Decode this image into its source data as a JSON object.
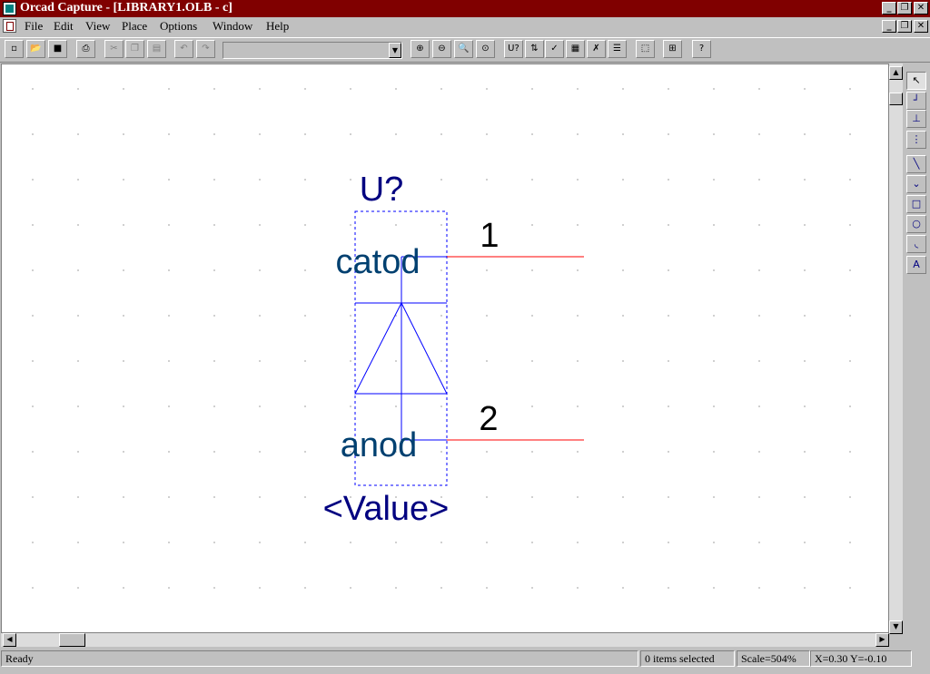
{
  "window": {
    "title": "Orcad Capture - [LIBRARY1.OLB - c]",
    "controls": [
      "_",
      "❐",
      "✕"
    ]
  },
  "menu": {
    "items": [
      "File",
      "Edit",
      "View",
      "Place",
      "Options",
      "Window",
      "Help"
    ]
  },
  "toolbar": {
    "buttons": [
      {
        "name": "new-icon",
        "glyph": "▫"
      },
      {
        "name": "open-icon",
        "glyph": "📂"
      },
      {
        "name": "save-icon",
        "glyph": "■"
      },
      {
        "name": "print-icon",
        "glyph": "⎙"
      },
      {
        "name": "cut-icon",
        "glyph": "✂"
      },
      {
        "name": "copy-icon",
        "glyph": "❐"
      },
      {
        "name": "paste-icon",
        "glyph": "▤"
      },
      {
        "name": "undo-icon",
        "glyph": "↶"
      },
      {
        "name": "redo-icon",
        "glyph": "↷"
      },
      {
        "name": "zoom-in-icon",
        "glyph": "⊕"
      },
      {
        "name": "zoom-out-icon",
        "glyph": "⊖"
      },
      {
        "name": "zoom-area-icon",
        "glyph": "🔍"
      },
      {
        "name": "zoom-all-icon",
        "glyph": "⊙"
      },
      {
        "name": "annotate-icon",
        "glyph": "U?"
      },
      {
        "name": "back-annotate-icon",
        "glyph": "⇅"
      },
      {
        "name": "drc-icon",
        "glyph": "✓"
      },
      {
        "name": "netlist-icon",
        "glyph": "▦"
      },
      {
        "name": "cross-reference-icon",
        "glyph": "✗"
      },
      {
        "name": "bill-of-materials-icon",
        "glyph": "☰"
      },
      {
        "name": "snap-to-grid-icon",
        "glyph": "⬚"
      },
      {
        "name": "project-manager-icon",
        "glyph": "⊞"
      },
      {
        "name": "help-icon",
        "glyph": "?"
      }
    ],
    "combo_value": ""
  },
  "part": {
    "ref": "U?",
    "value": "<Value>",
    "pins": [
      {
        "number": "1",
        "name": "catod"
      },
      {
        "number": "2",
        "name": "anod"
      }
    ]
  },
  "palette": [
    {
      "name": "select-tool-icon",
      "glyph": "↖",
      "active": true
    },
    {
      "name": "place-pin-icon",
      "glyph": "┘",
      "active": false
    },
    {
      "name": "place-pin-array-icon",
      "glyph": "⊥",
      "active": false
    },
    {
      "name": "ieee-symbol-icon",
      "glyph": "⋮",
      "active": false
    },
    {
      "name": "place-line-icon",
      "glyph": "╲",
      "active": false
    },
    {
      "name": "place-polyline-icon",
      "glyph": "⌄",
      "active": false
    },
    {
      "name": "place-rectangle-icon",
      "glyph": "□",
      "active": false
    },
    {
      "name": "place-ellipse-icon",
      "glyph": "○",
      "active": false
    },
    {
      "name": "place-arc-icon",
      "glyph": "◟",
      "active": false
    },
    {
      "name": "place-text-icon",
      "glyph": "A",
      "active": false
    }
  ],
  "status": {
    "ready": "Ready",
    "selection": "0 items selected",
    "scale": "Scale=504%",
    "coords": "X=0.30  Y=-0.10"
  },
  "colors": {
    "titlebar": "#800000",
    "part_body": "#0000ff",
    "pin_name": "#004070",
    "ref_text": "#000080",
    "pin_line": "#ff0000",
    "pin_number": "#000000"
  }
}
